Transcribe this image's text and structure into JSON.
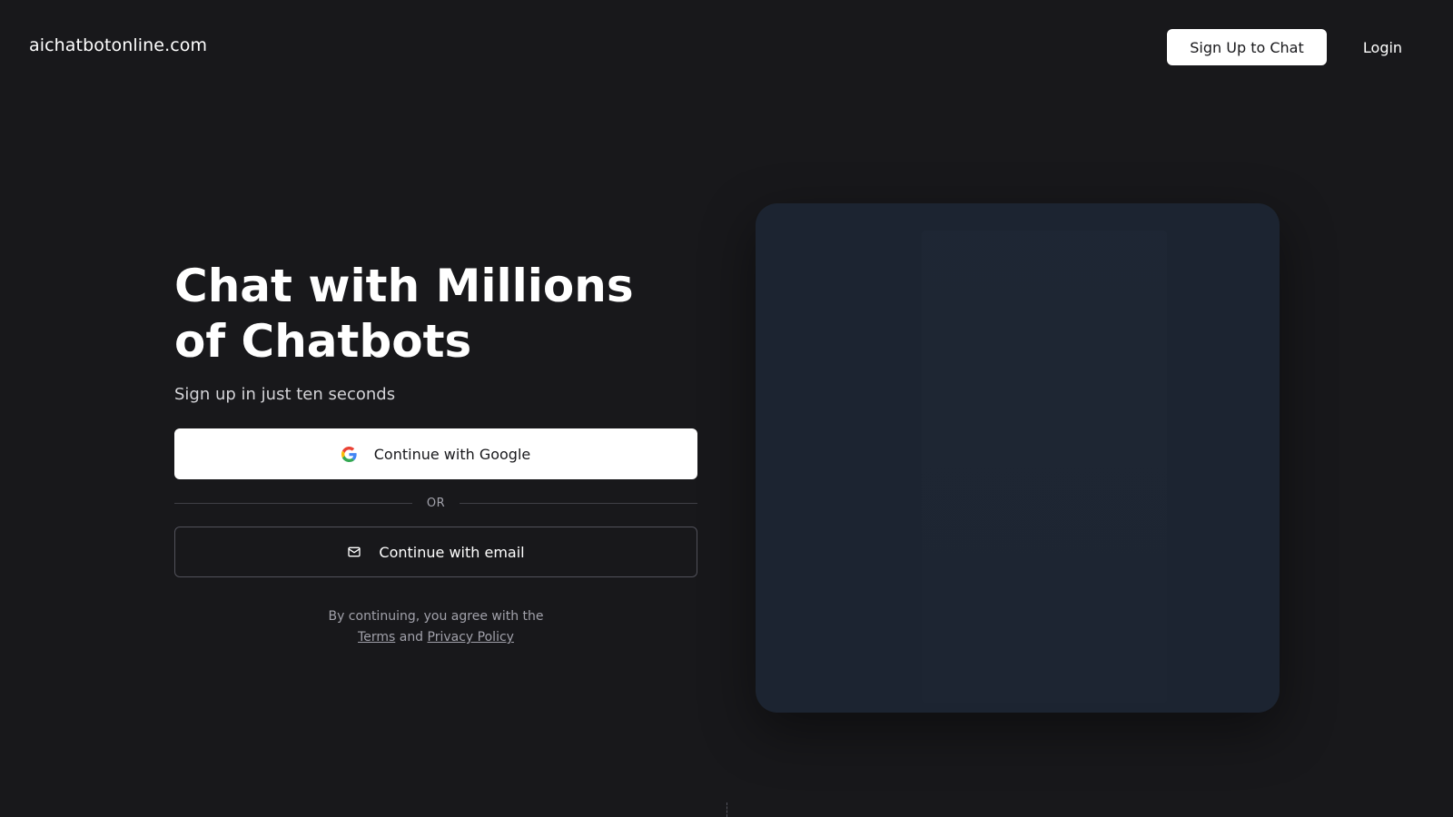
{
  "header": {
    "site_name": "aichatbotonline.com",
    "signup_label": "Sign Up to Chat",
    "login_label": "Login"
  },
  "hero": {
    "headline": "Chat with Millions of Chatbots",
    "subheadline": "Sign up in just ten seconds",
    "google_button_label": "Continue with Google",
    "divider_label": "OR",
    "email_button_label": "Continue with email",
    "legal_prefix": "By continuing, you agree with the",
    "legal_terms": "Terms",
    "legal_and": "and",
    "legal_privacy": "Privacy Policy"
  },
  "icons": {
    "google": "google-logo-icon",
    "email": "mail-icon"
  },
  "colors": {
    "background": "#18181b",
    "primary_button_bg": "#ffffff",
    "primary_button_text": "#18181b",
    "muted_text": "#a1a1aa",
    "media_panel": "#1c2431"
  }
}
